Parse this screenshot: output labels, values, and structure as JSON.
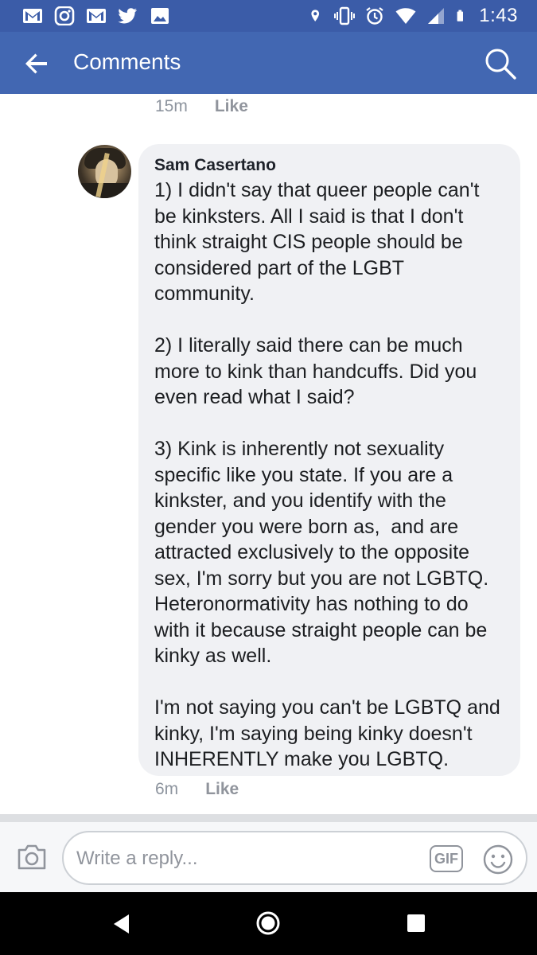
{
  "status_bar": {
    "time": "1:43",
    "left_icons": [
      "gmail-icon",
      "instagram-icon",
      "gmail-icon",
      "twitter-icon",
      "gallery-icon"
    ],
    "right_icons": [
      "location-icon",
      "vibrate-icon",
      "alarm-icon",
      "wifi-icon",
      "signal-icon",
      "battery-icon"
    ]
  },
  "header": {
    "title": "Comments",
    "back_icon": "arrow-left-icon",
    "search_icon": "search-icon"
  },
  "previous_comment": {
    "time": "15m",
    "like_label": "Like"
  },
  "comment": {
    "author": "Sam Casertano",
    "text": "1) I didn't say that queer people can't be kinksters. All I said is that I don't think straight CIS people should be considered part of the LGBT community.\n\n2) I literally said there can be much more to kink than handcuffs. Did you even read what I said?\n\n3) Kink is inherently not sexuality specific like you state. If you are a kinkster, and you identify with the gender you were born as,  and are attracted exclusively to the opposite sex, I'm sorry but you are not LGBTQ. Heteronormativity has nothing to do with it because straight people can be kinky as well.\n\nI'm not saying you can't be LGBTQ and kinky, I'm saying being kinky doesn't INHERENTLY make you LGBTQ.",
    "time": "6m",
    "like_label": "Like"
  },
  "reply": {
    "placeholder": "Write a reply...",
    "gif_label": "GIF",
    "camera_icon": "camera-icon",
    "emoji_icon": "smiley-icon"
  },
  "colors": {
    "status_bar": "#3b5ca8",
    "app_bar": "#4267b2",
    "bubble": "#f0f1f4",
    "meta_text": "#8d949e"
  }
}
